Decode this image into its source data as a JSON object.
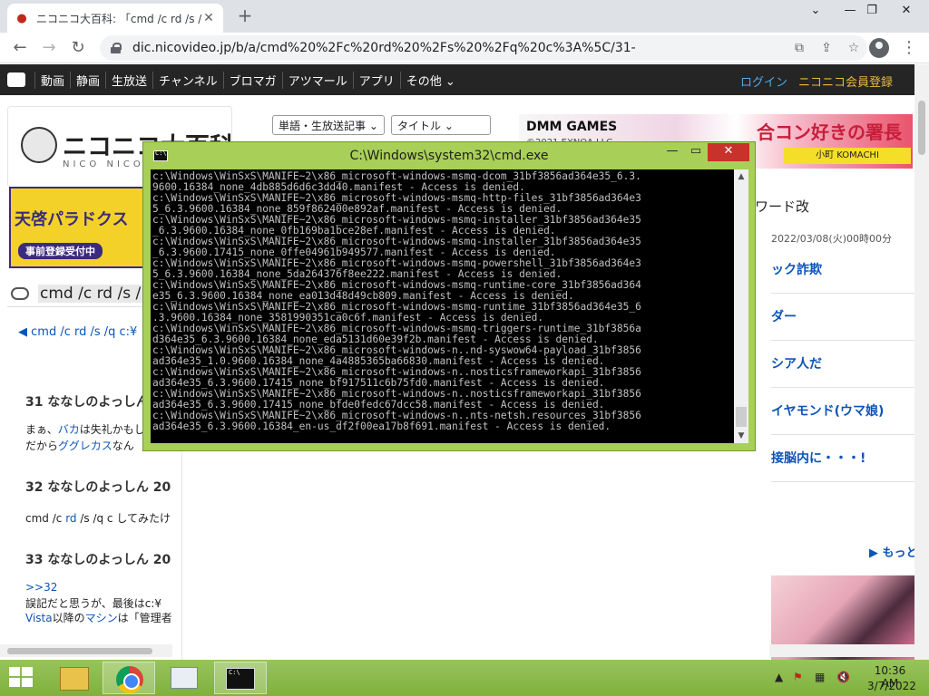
{
  "browser": {
    "tab_title": "ニコニコ大百科: 「cmd /c rd /s /q c:¥",
    "url": "dic.nicovideo.jp/b/a/cmd%20%2Fc%20rd%20%2Fs%20%2Fq%20c%3A%5C/31-"
  },
  "site_nav": {
    "items": [
      "動画",
      "静画",
      "生放送",
      "チャンネル",
      "ブロマガ",
      "アツマール",
      "アプリ",
      "その他 ⌄"
    ],
    "login": "ログイン",
    "register": "ニコニコ会員登録"
  },
  "header": {
    "logo_text": "ニコニコ大百科",
    "logo_sub": "NICO NICO",
    "select_type": "単語・生放送記事",
    "select_field": "タイトル",
    "banner_top": {
      "brand": "DMM GAMES",
      "copyright": "©2021 EXNOA LLC",
      "headline": "合コン好きの署長",
      "name": "小町 KOMACHI"
    },
    "banner_left": {
      "title": "天啓パラドクス",
      "cta": "事前登録受付中"
    }
  },
  "left": {
    "search_text": "cmd /c rd /s /",
    "back_link": "◀ cmd /c rd /s /q c:¥",
    "responses": [
      {
        "head": "31  ななしのよっしん",
        "lines": [
          {
            "pre": "まぁ、",
            "link": "バカ",
            "post": "は失礼かもし"
          },
          {
            "pre": "だから",
            "link": "ググレカス",
            "post": "なん"
          }
        ]
      },
      {
        "head": "32  ななしのよっしん  20",
        "lines": [
          {
            "pre": "cmd /c ",
            "link": "rd",
            "post": " /s /q c してみたけ"
          }
        ]
      },
      {
        "head": "33  ななしのよっしん  20",
        "lines": [
          {
            "pre": "",
            "link": ">>32",
            "post": ""
          },
          {
            "pre": "誤記だと思うが、最後はc:¥",
            "link": "",
            "post": ""
          },
          {
            "pre": "",
            "link": "Vista",
            "post": "以降の"
          },
          {
            "pre": "",
            "link": "マシン",
            "post": "は「管理者"
          }
        ]
      }
    ]
  },
  "right": {
    "rank_title": "ワード改",
    "rank_date": "2022/03/08(火)00時00分",
    "items": [
      "ック詐欺",
      "ダー",
      "シア人だ",
      "イヤモンド(ウマ娘)",
      "接脳内に・・・!"
    ],
    "more": "▶ もっと"
  },
  "cmd_window": {
    "title": "C:\\Windows\\system32\\cmd.exe",
    "icon_text": "C:\\",
    "lines": [
      "c:\\Windows\\WinSxS\\MANIFE~2\\x86_microsoft-windows-msmq-dcom_31bf3856ad364e35_6.3.",
      "9600.16384_none_4db885d6d6c3dd40.manifest - Access is denied.",
      "c:\\Windows\\WinSxS\\MANIFE~2\\x86_microsoft-windows-msmq-http-files_31bf3856ad364e3",
      "5_6.3.9600.16384_none_859f862400e892af.manifest - Access is denied.",
      "c:\\Windows\\WinSxS\\MANIFE~2\\x86_microsoft-windows-msmq-installer_31bf3856ad364e35",
      "_6.3.9600.16384_none_0fb169ba1bce28ef.manifest - Access is denied.",
      "c:\\Windows\\WinSxS\\MANIFE~2\\x86_microsoft-windows-msmq-installer_31bf3856ad364e35",
      "_6.3.9600.17415_none_0ffe04961b949577.manifest - Access is denied.",
      "c:\\Windows\\WinSxS\\MANIFE~2\\x86_microsoft-windows-msmq-powershell_31bf3856ad364e3",
      "5_6.3.9600.16384_none_5da264376f8ee222.manifest - Access is denied.",
      "c:\\Windows\\WinSxS\\MANIFE~2\\x86_microsoft-windows-msmq-runtime-core_31bf3856ad364",
      "e35_6.3.9600.16384_none_ea013d48d49cb809.manifest - Access is denied.",
      "c:\\Windows\\WinSxS\\MANIFE~2\\x86_microsoft-windows-msmq-runtime_31bf3856ad364e35_6",
      ".3.9600.16384_none_3581990351ca0c6f.manifest - Access is denied.",
      "c:\\Windows\\WinSxS\\MANIFE~2\\x86_microsoft-windows-msmq-triggers-runtime_31bf3856a",
      "d364e35_6.3.9600.16384_none_eda5131d60e39f2b.manifest - Access is denied.",
      "c:\\Windows\\WinSxS\\MANIFE~2\\x86_microsoft-windows-n..nd-syswow64-payload_31bf3856",
      "ad364e35_1.0.9600.16384_none_4a4885365ba66830.manifest - Access is denied.",
      "c:\\Windows\\WinSxS\\MANIFE~2\\x86_microsoft-windows-n..nosticsframeworkapi_31bf3856",
      "ad364e35_6.3.9600.17415_none_bf917511c6b75fd0.manifest - Access is denied.",
      "c:\\Windows\\WinSxS\\MANIFE~2\\x86_microsoft-windows-n..nosticsframeworkapi_31bf3856",
      "ad364e35_6.3.9600.17415_none_bfde0fedc67dcc58.manifest - Access is denied.",
      "c:\\Windows\\WinSxS\\MANIFE~2\\x86_microsoft-windows-n..nts-netsh.resources_31bf3856",
      "ad364e35_6.3.9600.16384_en-us_df2f00ea17b8f691.manifest - Access is denied."
    ]
  },
  "taskbar": {
    "time": "10:36 AM",
    "date": "3/7/2022"
  }
}
